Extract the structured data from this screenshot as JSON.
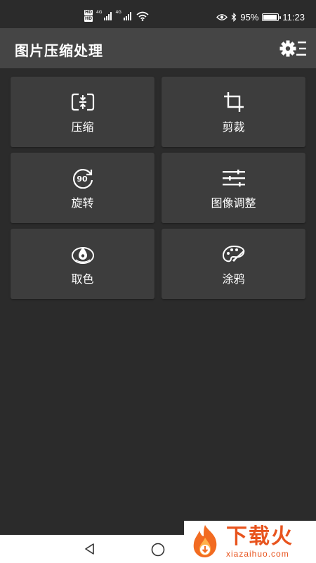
{
  "status_bar": {
    "hd_badge": "HD",
    "network_label": "4G",
    "battery_percent": "95%",
    "battery_level": 0.95,
    "time": "11:23"
  },
  "app_bar": {
    "title": "图片压缩处理",
    "settings_icon": "gear-list-icon"
  },
  "tiles": [
    {
      "label": "压缩",
      "icon": "compress-icon"
    },
    {
      "label": "剪裁",
      "icon": "crop-icon"
    },
    {
      "label": "旋转",
      "icon": "rotate-90-icon"
    },
    {
      "label": "图像调整",
      "icon": "sliders-icon"
    },
    {
      "label": "取色",
      "icon": "color-picker-icon"
    },
    {
      "label": "涂鸦",
      "icon": "palette-icon"
    }
  ],
  "watermark": {
    "text_cn": "下载火",
    "text_en": "xiazaihuo.com"
  },
  "colors": {
    "background": "#2b2b2b",
    "app_bar": "#454545",
    "tile": "#3d3d3d",
    "watermark_accent": "#e8541e"
  }
}
